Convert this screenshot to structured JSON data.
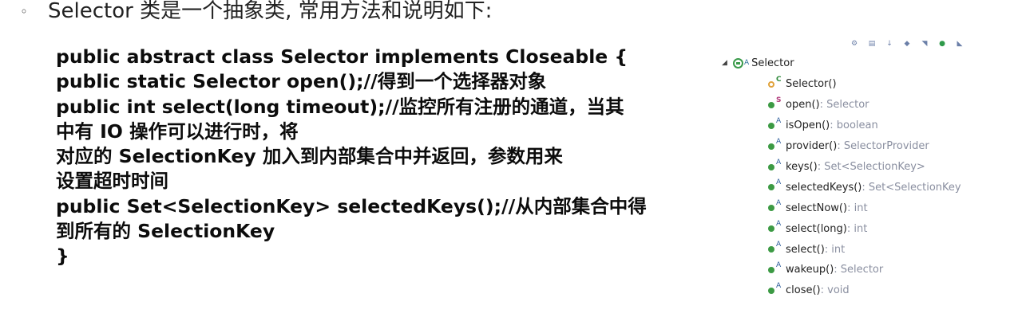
{
  "intro": {
    "bullet": "◦",
    "text": "Selector 类是一个抽象类, 常用方法和说明如下:"
  },
  "code_lines": [
    "public abstract class Selector implements Closeable {",
    "public static Selector open();//得到一个选择器对象",
    "public int select(long timeout);//监控所有注册的通道，当其",
    "中有 IO 操作可以进行时，将",
    "对应的 SelectionKey 加入到内部集合中并返回，参数用来",
    "设置超时时间",
    "public Set<SelectionKey> selectedKeys();//从内部集合中得",
    "到所有的 SelectionKey",
    "}"
  ],
  "outline": {
    "toolbar_icons": [
      "filter-icon",
      "collapse-icon",
      "sort-az-icon",
      "hide-fields-icon",
      "hide-static-icon",
      "hide-nonpublic-icon",
      "link-icon"
    ],
    "root": {
      "name": "Selector",
      "modifier": "A"
    },
    "members": [
      {
        "name": "Selector()",
        "type": "",
        "modifier": "C",
        "kind": "constructor"
      },
      {
        "name": "open()",
        "type": " : Selector",
        "modifier": "S",
        "kind": "method"
      },
      {
        "name": "isOpen()",
        "type": " : boolean",
        "modifier": "A",
        "kind": "method"
      },
      {
        "name": "provider()",
        "type": " : SelectorProvider",
        "modifier": "A",
        "kind": "method"
      },
      {
        "name": "keys()",
        "type": " : Set<SelectionKey>",
        "modifier": "A",
        "kind": "method"
      },
      {
        "name": "selectedKeys()",
        "type": " : Set<SelectionKey",
        "modifier": "A",
        "kind": "method"
      },
      {
        "name": "selectNow()",
        "type": " : int",
        "modifier": "A",
        "kind": "method"
      },
      {
        "name": "select(long)",
        "type": " : int",
        "modifier": "A",
        "kind": "method"
      },
      {
        "name": "select()",
        "type": " : int",
        "modifier": "A",
        "kind": "method"
      },
      {
        "name": "wakeup()",
        "type": " : Selector",
        "modifier": "A",
        "kind": "method"
      },
      {
        "name": "close()",
        "type": " : void",
        "modifier": "A",
        "kind": "method"
      }
    ]
  }
}
